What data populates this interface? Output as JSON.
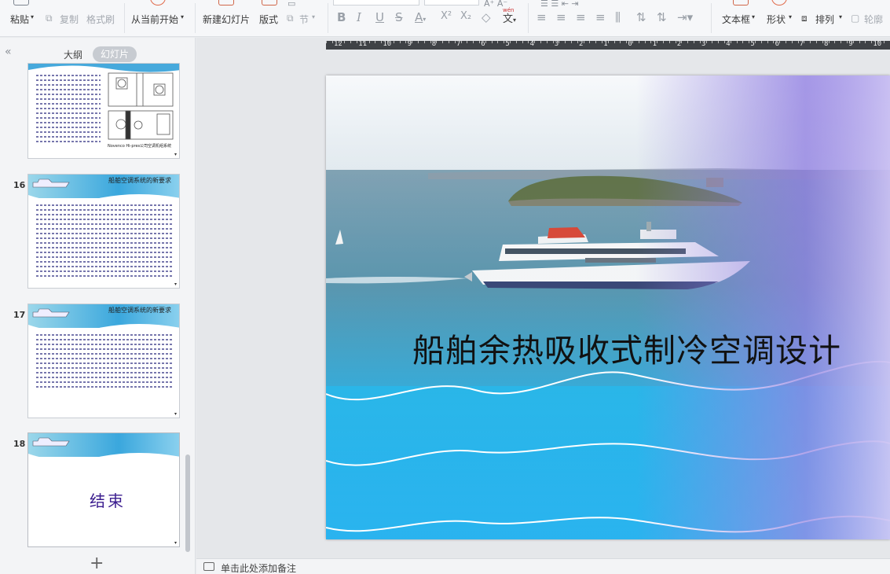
{
  "ribbon": {
    "paste": "粘贴",
    "copy": "复制",
    "format_painter": "格式刷",
    "from_current": "从当前开始",
    "new_slide": "新建幻灯片",
    "layout": "版式",
    "section": "节",
    "font_color_letter": "A",
    "bold": "B",
    "italic": "I",
    "underline": "U",
    "strike": "S",
    "superscript": "X²",
    "subscript": "X₂",
    "phonetic": "文",
    "text_box": "文本框",
    "shape": "形状",
    "arrange": "排列",
    "outline": "轮廓"
  },
  "left_panel": {
    "tab_outline": "大纲",
    "tab_slides": "幻灯片",
    "slides": [
      {
        "num": "16",
        "title": "船舶空调系统的新要求"
      },
      {
        "num": "17",
        "title": "船舶空调系统的新要求"
      },
      {
        "num": "18",
        "title": "",
        "end_text": "结束"
      }
    ],
    "thumb15_caption": "Novenco Hi-pres公司空调机组系统",
    "add": "+"
  },
  "ruler": {
    "labels": [
      "12",
      "11",
      "10",
      "9",
      "8",
      "7",
      "6",
      "5",
      "4",
      "3",
      "2",
      "1",
      "0",
      "1",
      "2",
      "3",
      "4",
      "5",
      "6",
      "7",
      "8",
      "9",
      "10"
    ]
  },
  "slide": {
    "title": "船舶余热吸收式制冷空调设计"
  },
  "notes": {
    "placeholder": "单击此处添加备注"
  }
}
